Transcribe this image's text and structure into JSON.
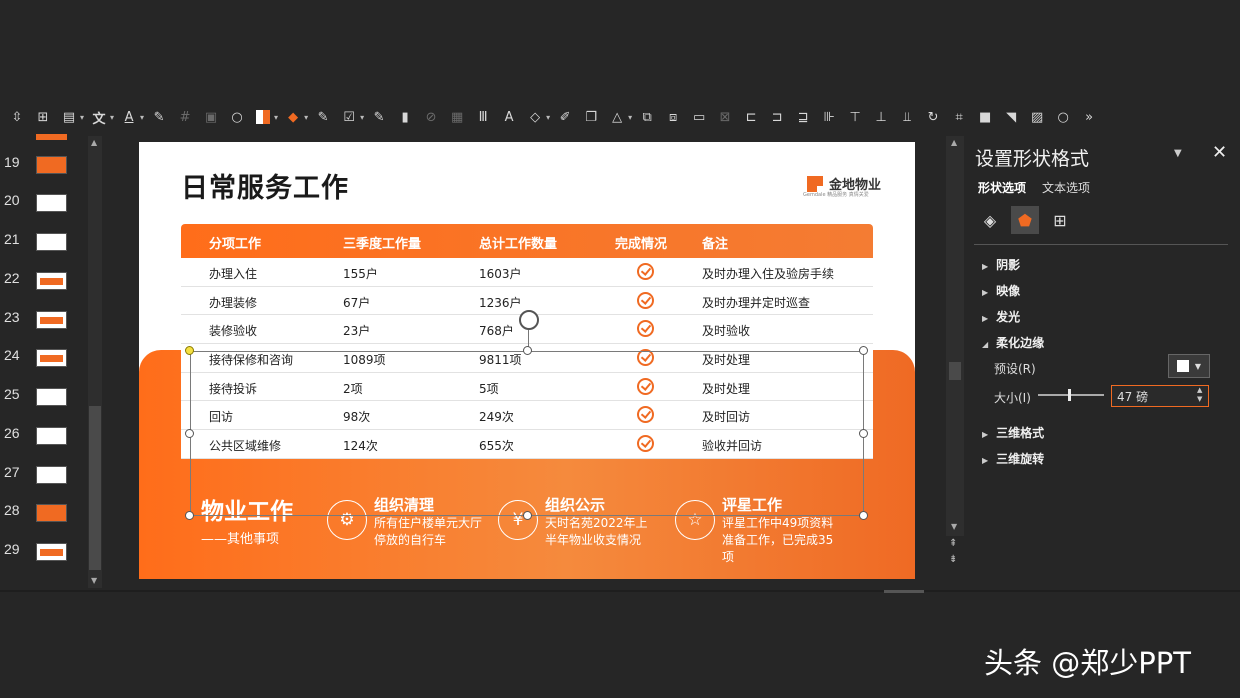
{
  "toolbar": {
    "icons": [
      "select-icon",
      "align-icon",
      "textbox-icon",
      "text-direction-icon",
      "font-color-icon",
      "eyedropper-icon",
      "link-icon",
      "picture-style-icon",
      "circle-shape-icon",
      "fill-color-icon",
      "paint-bucket-icon",
      "eyedropper-icon",
      "outline-icon",
      "eyedropper-icon",
      "chart-icon",
      "disabled-icon",
      "table-icon",
      "columns-icon",
      "text-effect-icon",
      "shape-icon",
      "brush-icon",
      "layers-icon",
      "image-adjust-icon",
      "arrange-icon",
      "group-icon",
      "caption-icon",
      "delete-icon",
      "align-left-icon",
      "align-center-icon",
      "align-right-icon",
      "distribute-icon",
      "align-top-icon",
      "align-middle-icon",
      "align-bottom-icon",
      "rotate-icon",
      "crop-icon",
      "square-icon",
      "fill-icon",
      "image-icon",
      "circle-icon",
      "more-icon"
    ]
  },
  "thumbnails": [
    {
      "num": "19"
    },
    {
      "num": "20"
    },
    {
      "num": "21"
    },
    {
      "num": "22"
    },
    {
      "num": "23"
    },
    {
      "num": "24"
    },
    {
      "num": "25"
    },
    {
      "num": "26"
    },
    {
      "num": "27"
    },
    {
      "num": "28"
    },
    {
      "num": "29"
    }
  ],
  "slide": {
    "title": "日常服务工作",
    "logo_text": "金地物业",
    "logo_sub": "Gemdale  精品服务 真情关爱",
    "table": {
      "headers": [
        "分项工作",
        "三季度工作量",
        "总计工作数量",
        "完成情况",
        "备注"
      ],
      "rows": [
        [
          "办理入住",
          "155户",
          "1603户",
          "及时办理入住及验房手续"
        ],
        [
          "办理装修",
          "67户",
          "1236户",
          "及时办理并定时巡查"
        ],
        [
          "装修验收",
          "23户",
          "768户",
          "及时验收"
        ],
        [
          "接待保修和咨询",
          "1089项",
          "9811项",
          "及时处理"
        ],
        [
          "接待投诉",
          "2项",
          "5项",
          "及时处理"
        ],
        [
          "回访",
          "98次",
          "249次",
          "及时回访"
        ],
        [
          "公共区域维修",
          "124次",
          "655次",
          "验收并回访"
        ]
      ]
    },
    "bottom": {
      "big_label": "物业工作",
      "big_sub": "——其他事项",
      "features": [
        {
          "title": "组织清理",
          "desc": "所有住户楼单元大厅停放的自行车",
          "icon": "cleanup-icon"
        },
        {
          "title": "组织公示",
          "desc": "天时名苑2022年上半年物业收支情况",
          "icon": "announcement-icon"
        },
        {
          "title": "评星工作",
          "desc": "评星工作中49项资料准备工作，已完成35项",
          "icon": "rating-icon"
        }
      ]
    }
  },
  "pane": {
    "title": "设置形状格式",
    "tab_shape": "形状选项",
    "tab_text": "文本选项",
    "sections": {
      "shadow": "阴影",
      "reflection": "映像",
      "glow": "发光",
      "soft_edges": "柔化边缘",
      "format_3d": "三维格式",
      "rotation_3d": "三维旋转"
    },
    "preset_label": "预设(R)",
    "size_label": "大小(I)",
    "size_value": "47 磅",
    "size_fraction": 0.45
  },
  "watermark": "头条 @郑少PPT",
  "colors": {
    "accent": "#f06a22",
    "bg": "#262626",
    "pane_bg": "#262626"
  }
}
